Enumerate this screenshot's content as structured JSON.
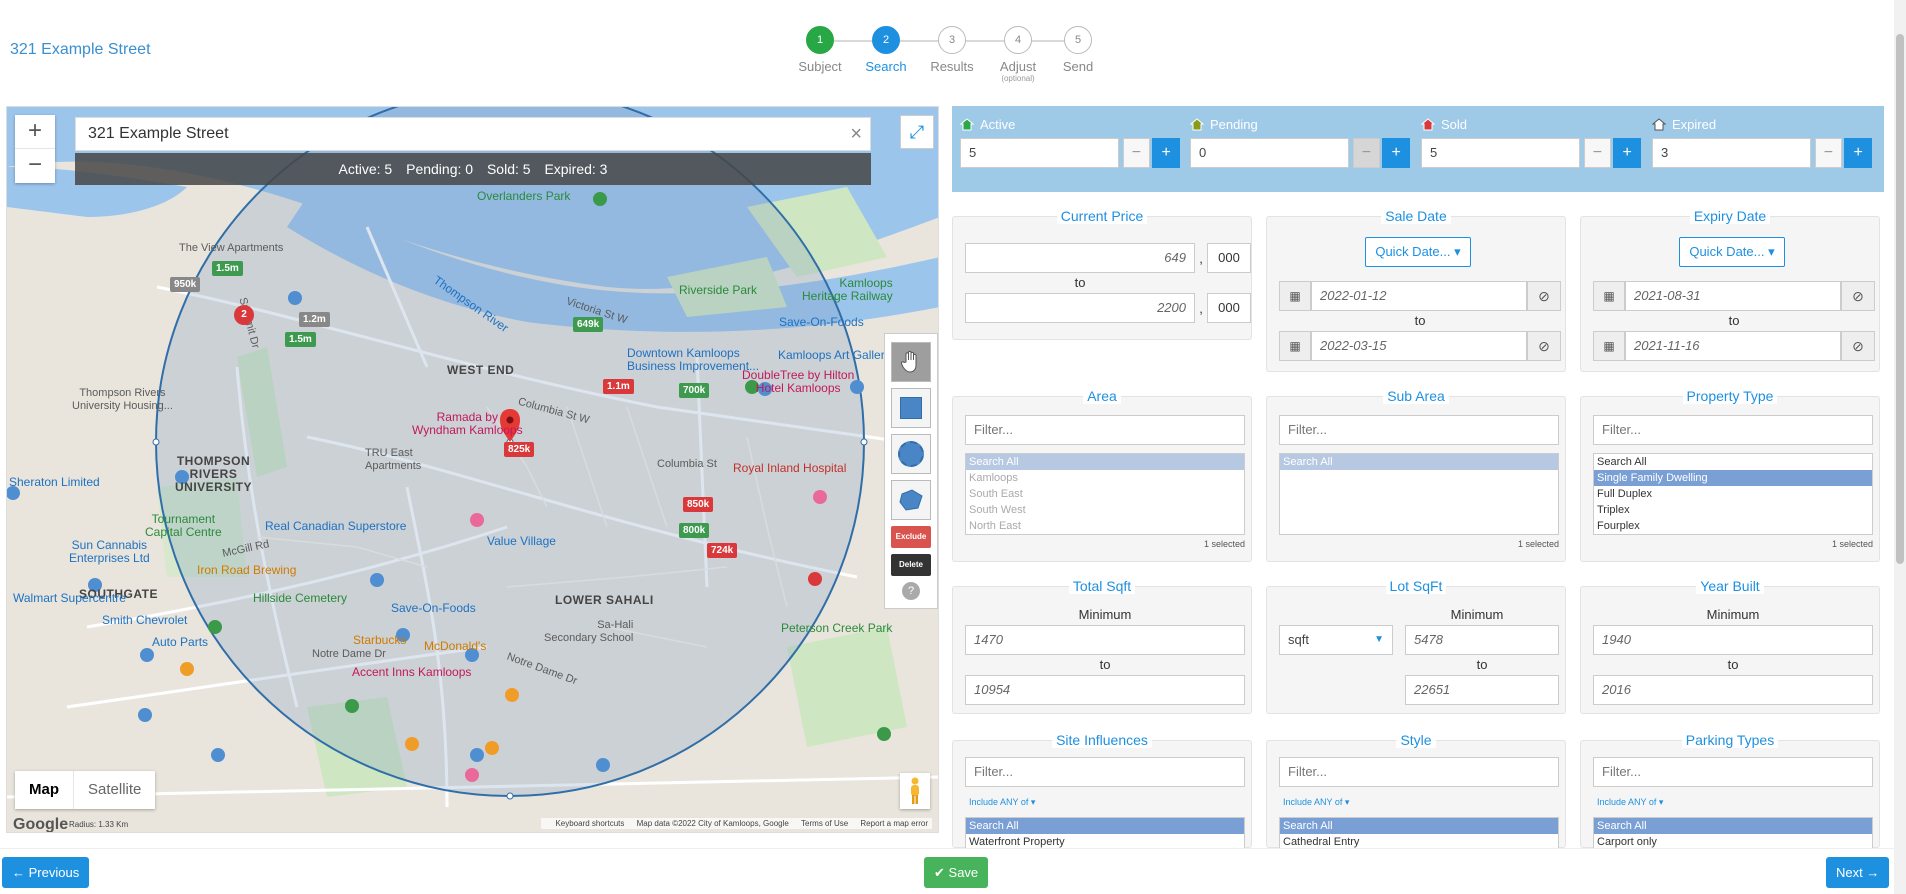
{
  "header": {
    "address": "321 Example Street"
  },
  "stepper": {
    "steps": [
      {
        "num": "1",
        "label": "Subject"
      },
      {
        "num": "2",
        "label": "Search"
      },
      {
        "num": "3",
        "label": "Results"
      },
      {
        "num": "4",
        "label": "Adjust",
        "sub": "(optional)"
      },
      {
        "num": "5",
        "label": "Send"
      }
    ]
  },
  "map": {
    "search_value": "321 Example Street",
    "counts": {
      "active": "Active: 5",
      "pending": "Pending: 0",
      "sold": "Sold: 5",
      "expired": "Expired: 3"
    },
    "tools": {
      "exclude": "Exclude",
      "delete": "Delete",
      "help": "?"
    },
    "map_type": {
      "map": "Map",
      "satellite": "Satellite"
    },
    "footer": {
      "logo": "Google",
      "radius": "Radius: 1.33 Km",
      "shortcuts": "Keyboard shortcuts",
      "data": "Map data ©2022 City of Kamloops, Google",
      "terms": "Terms of Use",
      "report": "Report a map error"
    },
    "labels": {
      "overlanders_park": "Overlanders Park",
      "thompson_river": "Thompson River",
      "view_apartments": "The View Apartments",
      "riverside_park": "Riverside Park",
      "heritage_railway": "Kamloops\nHeritage Railway",
      "save_on_foods_1": "Save-On-Foods",
      "downtown": "Downtown Kamloops\nBusiness Improvement...",
      "art_gallery": "Kamloops Art Gallery",
      "doubletree": "DoubleTree by Hilton\nHotel Kamloops",
      "west_end": "WEST END",
      "ramada": "Ramada by\nWyndham Kamloops",
      "royal_inland": "Royal Inland Hospital",
      "tru_east": "TRU East\nApartments",
      "thompson_univ_housing": "Thompson Rivers\nUniversity Housing...",
      "tru": "THOMPSON\nRIVERS\nUNIVERSITY",
      "sheraton": "Sheraton Limited",
      "tournament": "Tournament\nCapital Centre",
      "superstore": "Real Canadian Superstore",
      "value_village": "Value Village",
      "sun_cannabis": "Sun Cannabis\nEnterprises Ltd",
      "iron_road": "Iron Road Brewing",
      "southgate": "SOUTHGATE",
      "walmart": "Walmart Supercentre",
      "hillside_cemetery": "Hillside Cemetery",
      "save_on_foods_2": "Save-On-Foods",
      "lower_sahali": "LOWER SAHALI",
      "smith_chevrolet": "Smith Chevrolet",
      "auto_parts": "Auto Parts",
      "starbucks": "Starbucks",
      "mcdonalds": "McDonald's",
      "secondary_school": "Sa-Hali\nSecondary School",
      "peterson_creek": "Peterson Creek Park",
      "accent_inns": "Accent Inns Kamloops",
      "notre_dame_1": "Notre Dame Dr",
      "notre_dame_2": "Notre Dame Dr",
      "victoria": "Victoria St W",
      "columbia": "Columbia St W",
      "columbia_2": "Columbia St",
      "mcgill": "McGill Rd",
      "summit": "Summit Dr"
    },
    "tags": {
      "t1": "1.5m",
      "t2": "950k",
      "t3": "1.2m",
      "t4": "1.5m",
      "t5": "649k",
      "t6": "1.1m",
      "t7": "700k",
      "t8": "825k",
      "t9": "850k",
      "t10": "800k",
      "t11": "724k",
      "cluster": "2"
    }
  },
  "status": {
    "active": {
      "label": "Active",
      "value": "5"
    },
    "pending": {
      "label": "Pending",
      "value": "0"
    },
    "sold": {
      "label": "Sold",
      "value": "5"
    },
    "expired": {
      "label": "Expired",
      "value": "3"
    },
    "minus": "−",
    "plus": "+"
  },
  "current_price": {
    "title": "Current Price",
    "min": "649",
    "min_suffix": "000",
    "to": "to",
    "max": "2200",
    "max_suffix": "000",
    "comma": ","
  },
  "sale_date": {
    "title": "Sale Date",
    "quick": "Quick Date...",
    "from": "2022-01-12",
    "to_label": "to",
    "to": "2022-03-15"
  },
  "expiry_date": {
    "title": "Expiry Date",
    "quick": "Quick Date...",
    "from": "2021-08-31",
    "to_label": "to",
    "to": "2021-11-16"
  },
  "area": {
    "title": "Area",
    "filter_placeholder": "Filter...",
    "options": [
      "Search All",
      "Kamloops",
      "South East",
      "South West",
      "North East"
    ],
    "selected_count": "1 selected"
  },
  "sub_area": {
    "title": "Sub Area",
    "filter_placeholder": "Filter...",
    "options": [
      "Search All"
    ],
    "selected_count": "1 selected"
  },
  "property_type": {
    "title": "Property Type",
    "filter_placeholder": "Filter...",
    "options": [
      "Search All",
      "Single Family Dwelling",
      "Full Duplex",
      "Triplex",
      "Fourplex"
    ],
    "selected_count": "1 selected"
  },
  "total_sqft": {
    "title": "Total Sqft",
    "minimum": "Minimum",
    "min": "1470",
    "to": "to",
    "max": "10954"
  },
  "lot_sqft": {
    "title": "Lot SqFt",
    "minimum": "Minimum",
    "unit": "sqft",
    "min": "5478",
    "to": "to",
    "max": "22651"
  },
  "year_built": {
    "title": "Year Built",
    "minimum": "Minimum",
    "min": "1940",
    "to": "to",
    "max": "2016"
  },
  "site_influences": {
    "title": "Site Influences",
    "filter_placeholder": "Filter...",
    "include": "Include ANY of",
    "options": [
      "Search All",
      "Waterfront Property"
    ]
  },
  "style": {
    "title": "Style",
    "filter_placeholder": "Filter...",
    "include": "Include ANY of",
    "options": [
      "Search All",
      "Cathedral Entry"
    ]
  },
  "parking": {
    "title": "Parking Types",
    "filter_placeholder": "Filter...",
    "include": "Include ANY of",
    "options": [
      "Search All",
      "Carport only"
    ]
  },
  "footer": {
    "previous": "Previous",
    "save": "Save",
    "next": "Next"
  }
}
